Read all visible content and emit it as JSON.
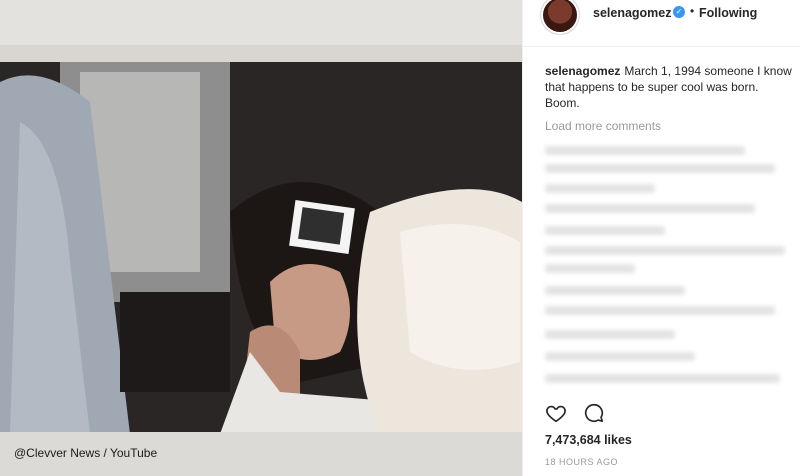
{
  "post": {
    "username": "selenagomez",
    "follow_separator": "•",
    "follow_status": "Following",
    "caption_user": "selenagomez",
    "caption_text": "March 1, 1994 someone I know that happens to be super cool was born. Boom.",
    "load_more": "Load more comments",
    "likes": "7,473,684 likes",
    "timestamp": "18 HOURS AGO"
  },
  "watermark": "@Clevver News / YouTube",
  "icons": {
    "verified": "verified-badge-icon",
    "like": "heart-icon",
    "comment": "comment-bubble-icon"
  },
  "colors": {
    "verified_blue": "#3897f0",
    "text": "#262626",
    "muted": "#999999"
  }
}
